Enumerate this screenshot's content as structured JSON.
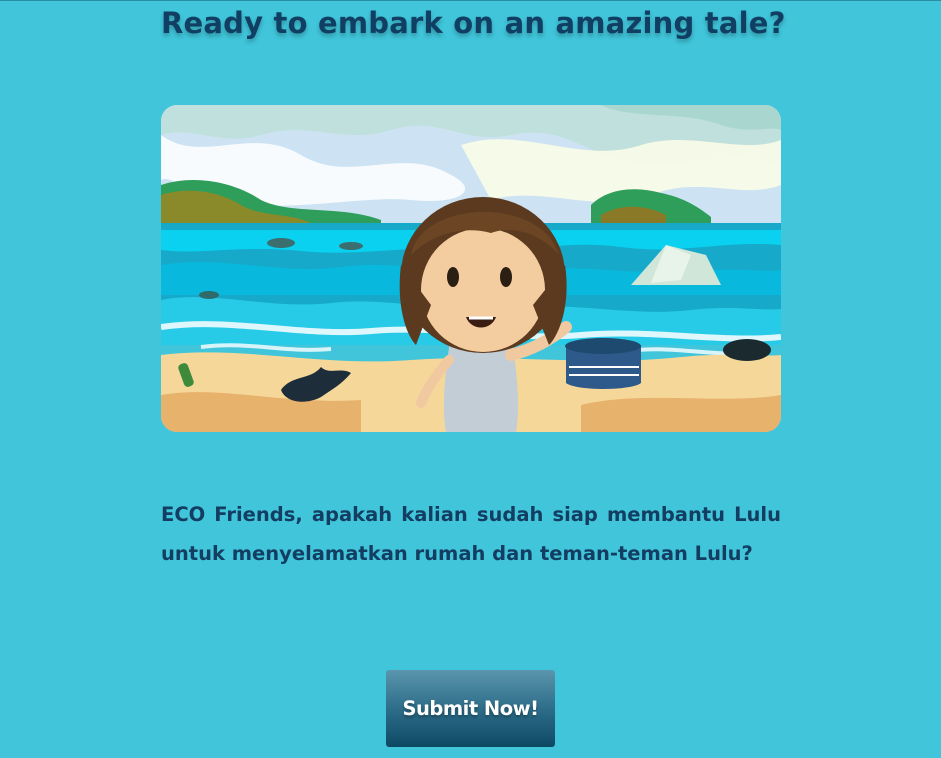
{
  "page": {
    "title": "Ready to embark on an amazing tale?",
    "story_text": "ECO Friends, apakah kalian sudah siap membantu Lulu untuk menyelamatkan rumah dan teman-teman Lulu?"
  },
  "illustration": {
    "subject": "Lulu on a polluted beach"
  },
  "actions": {
    "submit_label": "Submit Now!"
  },
  "colors": {
    "background": "#40c5da",
    "title": "#113f63",
    "text": "#133e62",
    "button_top": "#5a96ad",
    "button_bottom": "#0e4964",
    "button_text": "#ffffff"
  }
}
